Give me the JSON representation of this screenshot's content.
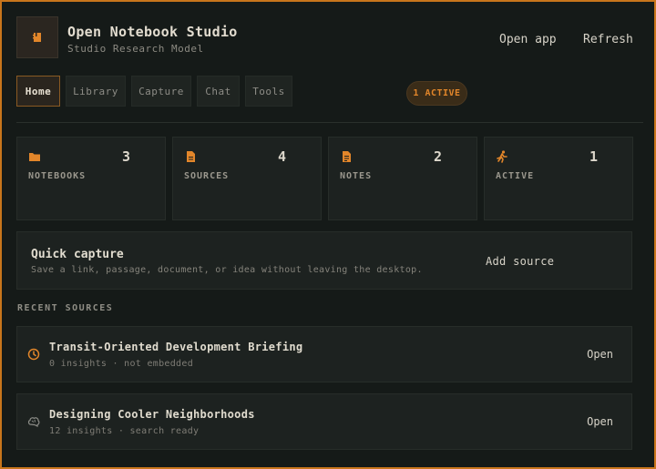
{
  "app": {
    "title": "Open Notebook Studio",
    "subtitle": "Studio Research Model",
    "logo_icon": "notebook-icon",
    "accent": "#e2862a"
  },
  "header": {
    "open_app_label": "Open app",
    "refresh_label": "Refresh"
  },
  "tabs": [
    {
      "label": "Home",
      "active": true
    },
    {
      "label": "Library",
      "active": false
    },
    {
      "label": "Capture",
      "active": false
    },
    {
      "label": "Chat",
      "active": false
    },
    {
      "label": "Tools",
      "active": false
    }
  ],
  "status_badge": "1 ACTIVE",
  "stats": [
    {
      "icon": "folder-icon",
      "value": "3",
      "label": "NOTEBOOKS"
    },
    {
      "icon": "document-icon",
      "value": "4",
      "label": "SOURCES"
    },
    {
      "icon": "note-icon",
      "value": "2",
      "label": "NOTES"
    },
    {
      "icon": "running-person-icon",
      "value": "1",
      "label": "ACTIVE"
    }
  ],
  "quick_capture": {
    "title": "Quick capture",
    "description": "Save a link, passage, document, or idea without leaving the desktop.",
    "button_label": "Add source"
  },
  "recent_sources": {
    "heading": "RECENT SOURCES",
    "items": [
      {
        "icon": "clock-icon",
        "title": "Transit-Oriented Development Briefing",
        "meta": "0 insights · not embedded",
        "open_label": "Open"
      },
      {
        "icon": "brain-icon",
        "title": "Designing Cooler Neighborhoods",
        "meta": "12 insights · search ready",
        "open_label": "Open"
      }
    ]
  }
}
